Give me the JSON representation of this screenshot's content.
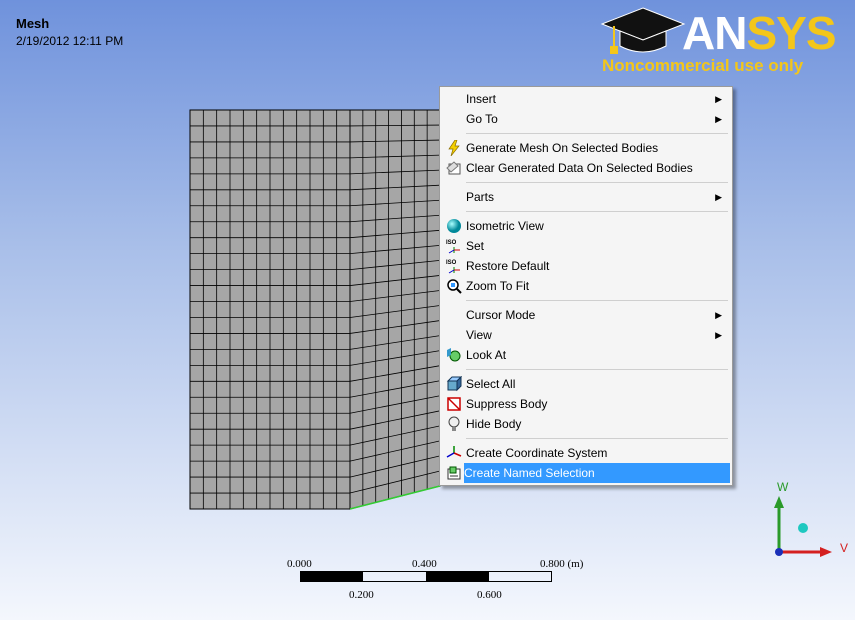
{
  "header": {
    "title": "Mesh",
    "datetime": "2/19/2012 12:11 PM"
  },
  "logo": {
    "brand_part1": "AN",
    "brand_part2": "SYS",
    "tagline": "Noncommercial use only"
  },
  "context_menu": {
    "items": [
      {
        "label": "Insert",
        "icon": "",
        "submenu": true
      },
      {
        "label": "Go To",
        "icon": "",
        "submenu": true
      },
      {
        "label": "Generate Mesh On Selected Bodies",
        "icon": "lightning-icon"
      },
      {
        "label": "Clear Generated Data On Selected Bodies",
        "icon": "clear-data-icon"
      },
      {
        "label": "Parts",
        "icon": "",
        "submenu": true
      },
      {
        "label": "Isometric View",
        "icon": "isometric-view-icon"
      },
      {
        "label": "Set",
        "icon": "iso-set-icon"
      },
      {
        "label": "Restore Default",
        "icon": "iso-restore-icon"
      },
      {
        "label": "Zoom To Fit",
        "icon": "zoom-fit-icon"
      },
      {
        "label": "Cursor Mode",
        "icon": "",
        "submenu": true
      },
      {
        "label": "View",
        "icon": "",
        "submenu": true
      },
      {
        "label": "Look At",
        "icon": "look-at-icon"
      },
      {
        "label": "Select All",
        "icon": "select-all-icon"
      },
      {
        "label": "Suppress Body",
        "icon": "suppress-body-icon"
      },
      {
        "label": "Hide Body",
        "icon": "hide-body-icon"
      },
      {
        "label": "Create Coordinate System",
        "icon": "coordinate-system-icon"
      },
      {
        "label": "Create Named Selection",
        "icon": "named-selection-icon",
        "highlighted": true
      }
    ]
  },
  "scale_bar": {
    "top_labels": [
      "0.000",
      "0.400",
      "0.800 (m)"
    ],
    "bottom_labels": [
      "0.200",
      "0.600"
    ]
  },
  "triad": {
    "w": "W",
    "v": "V"
  },
  "colors": {
    "highlight": "#3399ff",
    "mesh_face": "#a6a6a6",
    "brand_yellow": "#f3c61a"
  }
}
